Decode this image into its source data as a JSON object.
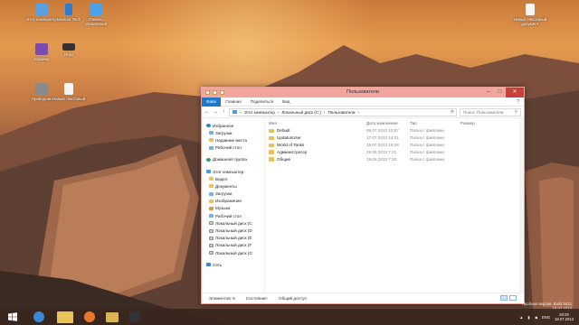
{
  "desktop": {
    "icons": [
      {
        "label": "Этот компьютер",
        "color": "#5a9fe0"
      },
      {
        "label": "Moskva Tech",
        "color": "#2f7bd1"
      },
      {
        "label": "Панель управления",
        "color": "#4aa3e8"
      },
      {
        "label": "Корзина",
        "color": "#9cc7e8"
      },
      {
        "label": "Игры",
        "color": "#7a4bb0"
      },
      {
        "label": "Игры",
        "color": "#333333"
      },
      {
        "label": "Проводник",
        "color": "#8a8a8a"
      },
      {
        "label": "Новый текстовый",
        "color": "#f5f5f5"
      },
      {
        "label": "Новый текстовый документ",
        "color": "#f5f5f5"
      }
    ],
    "watermark": {
      "line1": "Пробная версия. Build 9431",
      "line2": "15.07.2013"
    }
  },
  "window": {
    "title": "Пользователи",
    "ribbon_tabs": [
      "Файл",
      "Главная",
      "Поделиться",
      "Вид"
    ],
    "help": "?",
    "address": {
      "path": [
        "Этот компьютер",
        "Локальный диск (C:)",
        "Пользователи"
      ]
    },
    "search_placeholder": "Поиск: Пользователи",
    "nav_pane": {
      "favorites": {
        "label": "Избранное",
        "items": [
          "Загрузки",
          "Недавние места",
          "Рабочий стол"
        ]
      },
      "homegroup": "Домашняя группа",
      "this_pc": {
        "label": "Этот компьютер",
        "items": [
          "Видео",
          "Документы",
          "Загрузки",
          "Изображения",
          "Музыка",
          "Рабочий стол",
          "Локальный диск (C",
          "Локальный диск (D",
          "Локальный диск (E",
          "Локальный диск (F",
          "Локальный диск (G"
        ]
      },
      "network": "Сеть"
    },
    "columns": {
      "name": "Имя",
      "date": "Дата изменения",
      "type": "Тип",
      "size": "Размер"
    },
    "files": [
      {
        "name": "Default",
        "date": "09.07.2013 10:57",
        "type": "Папка с файлами"
      },
      {
        "name": "UpdatusUser",
        "date": "17.07.2013 14:31",
        "type": "Папка с файлами"
      },
      {
        "name": "World of Tanks",
        "date": "18.07.2013 16:28",
        "type": "Папка с файлами"
      },
      {
        "name": "Администратор",
        "date": "29.06.2013 7:21",
        "type": "Папка с файлами"
      },
      {
        "name": "Общие",
        "date": "19.06.2013 7:20",
        "type": "Папка с файлами"
      }
    ],
    "status": {
      "count": "Элементов: 5",
      "state": "Состояние:",
      "state_value": "Общий доступ"
    }
  },
  "taskbar": {
    "apps": [
      "start-button",
      "ie-icon",
      "explorer-icon",
      "firefox-icon",
      "folder-icon",
      "media-icon"
    ],
    "lang": "ENG",
    "time": "20:29",
    "date": "18.07.2013"
  }
}
